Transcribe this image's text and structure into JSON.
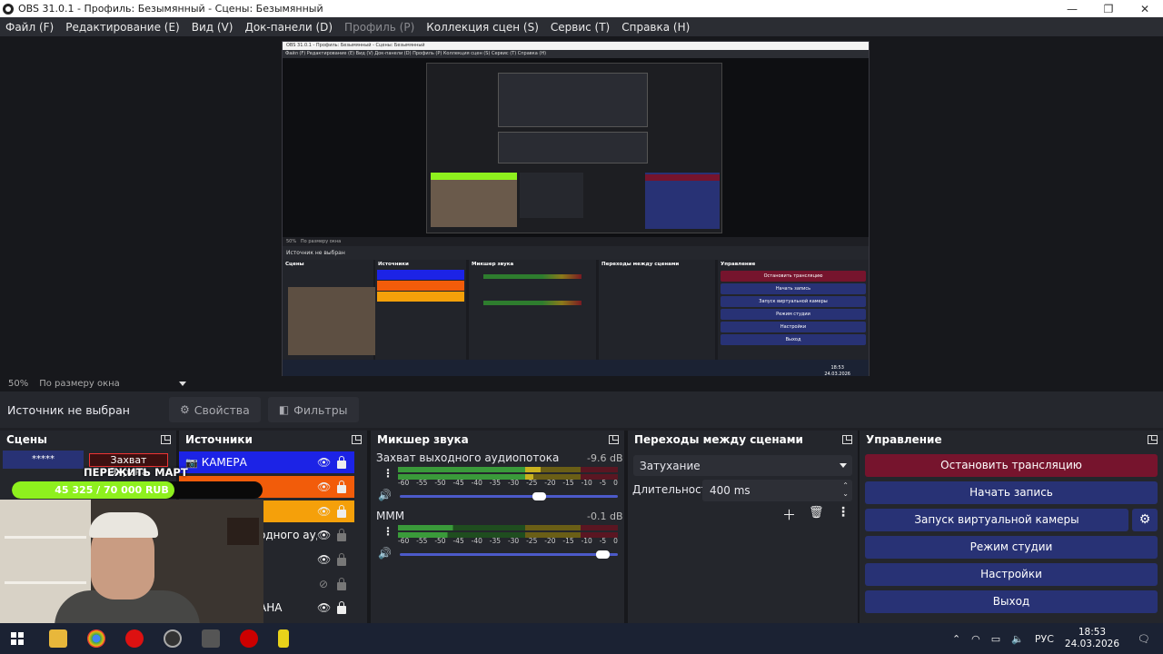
{
  "window": {
    "title": "OBS 31.0.1 - Профиль: Безымянный - Сцены: Безымянный",
    "controls": [
      "—",
      "❐",
      "✕"
    ]
  },
  "menu": [
    {
      "label": "Файл (F)",
      "disabled": false
    },
    {
      "label": "Редактирование (E)",
      "disabled": false
    },
    {
      "label": "Вид (V)",
      "disabled": false
    },
    {
      "label": "Док-панели (D)",
      "disabled": false
    },
    {
      "label": "Профиль (P)",
      "disabled": true
    },
    {
      "label": "Коллекция сцен (S)",
      "disabled": false
    },
    {
      "label": "Сервис (T)",
      "disabled": false
    },
    {
      "label": "Справка (H)",
      "disabled": false
    }
  ],
  "nested_preview": {
    "title": "OBS 31.0.1 - Профиль: Безымянный - Сцены: Безымянный",
    "menu": "Файл (F)   Редактирование (E)   Вид (V)   Док-панели (D)   Профиль (P)   Коллекция сцен (S)   Сервис (T)   Справка (H)",
    "zoom": "50%",
    "zoom_mode": "По размеру окна",
    "no_source": "Источник не выбран",
    "docks": [
      "Сцены",
      "Источники",
      "Микшер звука",
      "Переходы между сценами",
      "Управление"
    ],
    "controls": [
      "Остановить трансляцию",
      "Начать запись",
      "Запуск виртуальной камеры",
      "Режим студии",
      "Настройки",
      "Выход"
    ],
    "clock": "18:53",
    "date": "24.03.2026"
  },
  "zoom": {
    "value": "50%",
    "mode": "По размеру окна"
  },
  "source_toolbar": {
    "no_source": "Источник не выбран",
    "properties": "Свойства",
    "filters": "Фильтры"
  },
  "docks": {
    "scenes": {
      "title": "Сцены",
      "items": [
        "*****"
      ]
    },
    "sources": {
      "title": "Источники",
      "items": [
        {
          "label": "КАМЕРА",
          "color": "#1c23e6",
          "icon": "camera-icon",
          "visible": true
        },
        {
          "label": "",
          "color": "#f25c0a",
          "icon": "",
          "visible": true
        },
        {
          "label": "",
          "color": "#f5a00a",
          "icon": "",
          "visible": true
        },
        {
          "label": "одного аудио",
          "color": "",
          "icon": "",
          "visible": true
        },
        {
          "label": "",
          "color": "",
          "icon": "",
          "visible": true
        },
        {
          "label": "",
          "color": "",
          "icon": "",
          "visible": false
        },
        {
          "label": "",
          "color": "",
          "icon": "",
          "visible": true
        },
        {
          "label": "АНА",
          "color": "",
          "icon": "",
          "visible": true
        }
      ]
    },
    "overlay": {
      "screen_capture": "Захват Экрана",
      "donation_title": "ПЕРЕЖИТЬ МАРТ",
      "donation_text": "45 325 / 70 000 RUB",
      "donation_progress": 0.6475
    },
    "mixer": {
      "title": "Микшер звука",
      "channels": [
        {
          "name": "Захват выходного аудиопотока",
          "db": "-9.6 dB",
          "level": 0.65,
          "volume": 0.65
        },
        {
          "name": "МММ",
          "db": "-0.1 dB",
          "level": 0.25,
          "volume": 0.96
        }
      ],
      "ticks": [
        "-60",
        "-55",
        "-50",
        "-45",
        "-40",
        "-35",
        "-30",
        "-25",
        "-20",
        "-15",
        "-10",
        "-5",
        "0"
      ]
    },
    "transitions": {
      "title": "Переходы между сценами",
      "selected": "Затухание",
      "duration_label": "Длительность",
      "duration_value": "400 ms"
    },
    "controls": {
      "title": "Управление",
      "stop_stream": "Остановить трансляцию",
      "start_record": "Начать запись",
      "virtual_cam": "Запуск виртуальной камеры",
      "studio_mode": "Режим студии",
      "settings": "Настройки",
      "exit": "Выход"
    }
  },
  "taskbar": {
    "lang": "РУС",
    "time": "18:53",
    "date": "24.03.2026",
    "notifications": "1"
  },
  "colors": {
    "accent_blue": "#283275",
    "stop_red": "#76142d",
    "donation_green": "#8ef01e"
  }
}
